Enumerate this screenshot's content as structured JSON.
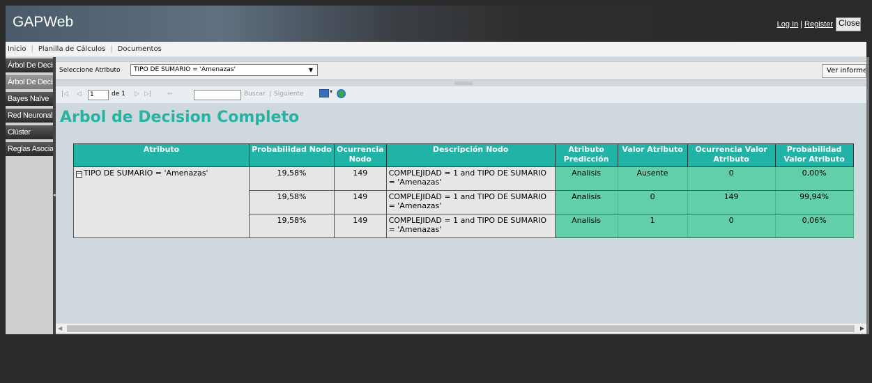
{
  "header": {
    "app_title": "GAPWeb",
    "login": "Log In",
    "separator": "|",
    "register": "Register",
    "close": "Close"
  },
  "menu": {
    "items": [
      "Inicio",
      "Planilla de Cálculos",
      "Documentos"
    ]
  },
  "sidebar": {
    "items": [
      {
        "label": "Árbol De Decisión"
      },
      {
        "label": "Árbol De Decisión"
      },
      {
        "label": "Bayes Naïve"
      },
      {
        "label": "Red Neuronal"
      },
      {
        "label": "Clúster"
      },
      {
        "label": "Reglas Asociación"
      }
    ]
  },
  "params": {
    "label": "Seleccione Atributo",
    "selected": "TIPO DE SUMARIO = 'Amenazas'",
    "view_button": "Ver informe"
  },
  "toolbar": {
    "page": "1",
    "of_label": "de 1",
    "find": "Buscar",
    "bar": "|",
    "next": "Siguiente"
  },
  "report": {
    "title": "Arbol de Decision Completo",
    "headers": [
      "Atributo",
      "Probabilidad Nodo",
      "Ocurrencia Nodo",
      "Descripción Nodo",
      "Atributo Predicción",
      "Valor Atributo",
      "Ocurrencia Valor Atributo",
      "Probabilidad Valor Atributo"
    ],
    "group_label": "TIPO DE SUMARIO = 'Amenazas'",
    "rows": [
      {
        "prob": "19,58%",
        "occ": "149",
        "desc": "COMPLEJIDAD = 1 and TIPO DE SUMARIO = 'Amenazas'",
        "pred": "Analisis",
        "val": "Ausente",
        "occval": "0",
        "probval": "0,00%"
      },
      {
        "prob": "19,58%",
        "occ": "149",
        "desc": "COMPLEJIDAD = 1 and TIPO DE SUMARIO = 'Amenazas'",
        "pred": "Analisis",
        "val": "0",
        "occval": "149",
        "probval": "99,94%"
      },
      {
        "prob": "19,58%",
        "occ": "149",
        "desc": "COMPLEJIDAD = 1 and TIPO DE SUMARIO = 'Amenazas'",
        "pred": "Analisis",
        "val": "1",
        "occval": "0",
        "probval": "0,06%"
      }
    ]
  },
  "colors": {
    "accent": "#22b3a7",
    "green_cell": "#63cfa9",
    "title": "#25b3a3"
  }
}
